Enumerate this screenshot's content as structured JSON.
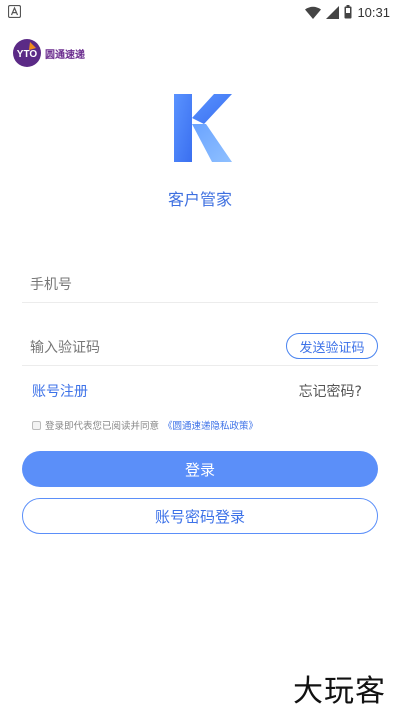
{
  "status_bar": {
    "time": "10:31",
    "left_icon": "notification-a-icon",
    "right_icons": [
      "wifi-icon",
      "signal-icon",
      "battery-icon"
    ]
  },
  "brand": {
    "logo_icon": "yto-logo-icon",
    "logo_text": "YTO",
    "name": "圆通速递"
  },
  "app": {
    "logo_icon": "k-logo-icon",
    "title": "客户管家"
  },
  "form": {
    "phone_placeholder": "手机号",
    "code_placeholder": "输入验证码",
    "send_code_label": "发送验证码"
  },
  "links": {
    "register": "账号注册",
    "forgot": "忘记密码?"
  },
  "agreement": {
    "checked": false,
    "text": "登录即代表您已阅读并同意",
    "policy": "《圆通速递隐私政策》"
  },
  "buttons": {
    "login": "登录",
    "password_login": "账号密码登录"
  },
  "watermark": "大玩客",
  "colors": {
    "accent": "#5b8ff9",
    "link": "#3d72e8",
    "brand_purple": "#6b2d8f"
  }
}
